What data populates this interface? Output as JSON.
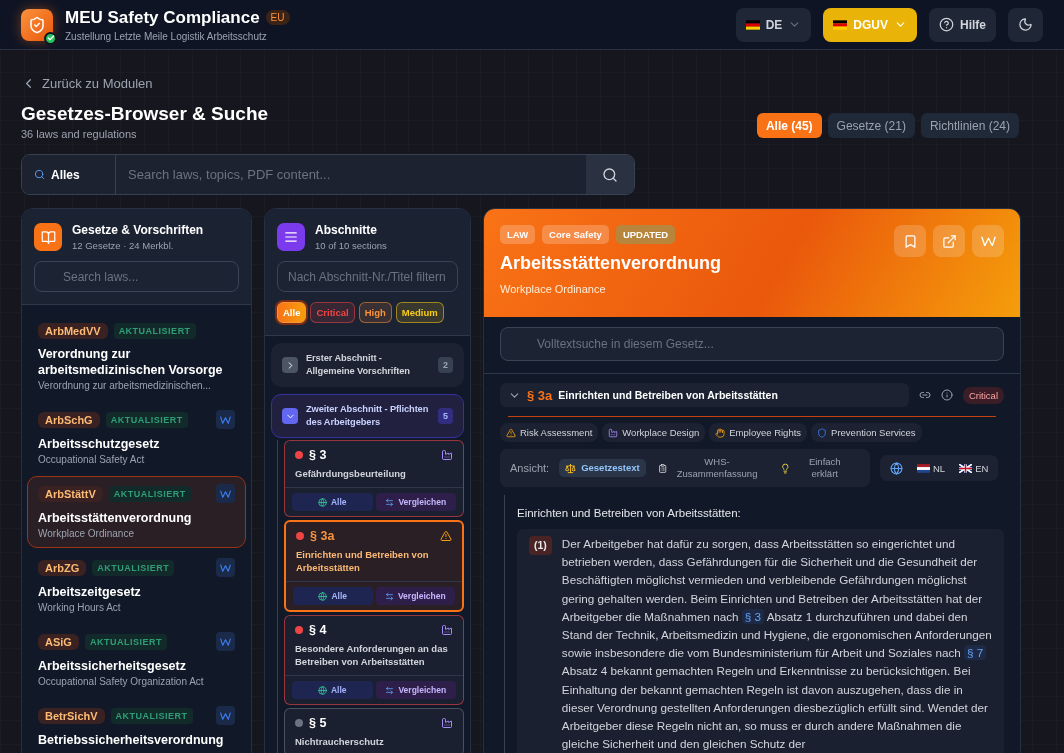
{
  "header": {
    "title": "MEU Safety Compliance",
    "region": "EU",
    "subtitle": "Zustellung Letzte Meile Logistik Arbeitsschutz",
    "language": "DE",
    "authority": "DGUV",
    "help": "Hilfe"
  },
  "page": {
    "back": "Zurück zu Modulen",
    "title": "Gesetzes-Browser & Suche",
    "subtitle": "36 laws and regulations",
    "filters": [
      {
        "label": "Alle (45)",
        "selected": true
      },
      {
        "label": "Gesetze (21)",
        "selected": false
      },
      {
        "label": "Richtlinien (24)",
        "selected": false
      }
    ],
    "scope": "Alles",
    "search_placeholder": "Search laws, topics, PDF content..."
  },
  "laws": {
    "title": "Gesetze & Vorschriften",
    "subtitle": "12 Gesetze · 24 Merkbl.",
    "search_placeholder": "Search laws...",
    "items": [
      {
        "abbr": "ArbMedVV",
        "status": "AKTUALISIERT",
        "title": "Verordnung zur arbeitsmedizinischen Vorsorge",
        "subtitle": "Verordnung zur arbeitsmedizinischen...",
        "wiki": false,
        "selected": false
      },
      {
        "abbr": "ArbSchG",
        "status": "AKTUALISIERT",
        "title": "Arbeitsschutzgesetz",
        "subtitle": "Occupational Safety Act",
        "wiki": true,
        "selected": false
      },
      {
        "abbr": "ArbStättV",
        "status": "AKTUALISIERT",
        "title": "Arbeitsstättenverordnung",
        "subtitle": "Workplace Ordinance",
        "wiki": true,
        "selected": true
      },
      {
        "abbr": "ArbZG",
        "status": "AKTUALISIERT",
        "title": "Arbeitszeitgesetz",
        "subtitle": "Working Hours Act",
        "wiki": true,
        "selected": false
      },
      {
        "abbr": "ASiG",
        "status": "AKTUALISIERT",
        "title": "Arbeitssicherheitsgesetz",
        "subtitle": "Occupational Safety Organization Act",
        "wiki": true,
        "selected": false
      },
      {
        "abbr": "BetrSichV",
        "status": "AKTUALISIERT",
        "title": "Betriebssicherheitsverordnung",
        "wiki": true,
        "selected": false
      }
    ]
  },
  "sections": {
    "title": "Abschnitte",
    "subtitle": "10 of 10 sections",
    "filter_placeholder": "Nach Abschnitt-Nr./Titel filtern",
    "severity": [
      {
        "label": "Alle",
        "selected": true,
        "color": "#f97316"
      },
      {
        "label": "Critical",
        "selected": false,
        "color": "#ef4444"
      },
      {
        "label": "High",
        "selected": false,
        "color": "#fb923c"
      },
      {
        "label": "Medium",
        "selected": false,
        "color": "#facc15"
      }
    ],
    "groups": [
      {
        "title": "Erster Abschnitt - Allgemeine Vorschriften",
        "count": "2",
        "expanded": false
      },
      {
        "title": "Zweiter Abschnitt - Pflichten des Arbeitgebers",
        "count": "5",
        "expanded": true,
        "children": [
          {
            "number": "§ 3",
            "title": "Gefährdungsbeurteilung",
            "color": "#ef4444",
            "kind": "factory",
            "selected": false,
            "buttons": [
              "Alle",
              "Vergleichen"
            ]
          },
          {
            "number": "§ 3a",
            "title": "Einrichten und Betreiben von Arbeitsstätten",
            "color": "#ef4444",
            "kind": "warning",
            "selected": true,
            "buttons": [
              "Alle",
              "Vergleichen"
            ]
          },
          {
            "number": "§ 4",
            "title": "Besondere Anforderungen an das Betreiben von Arbeitsstätten",
            "color": "#ef4444",
            "kind": "factory",
            "selected": false,
            "buttons": [
              "Alle",
              "Vergleichen"
            ]
          },
          {
            "number": "§ 5",
            "title": "Nichtraucherschutz",
            "color": "#6b7280",
            "kind": "factory",
            "selected": false
          }
        ]
      }
    ]
  },
  "detail": {
    "badges": [
      {
        "label": "LAW",
        "kind": "plain"
      },
      {
        "label": "Core Safety",
        "kind": "plain"
      },
      {
        "label": "UPDATED",
        "kind": "updated"
      }
    ],
    "title": "Arbeitsstättenverordnung",
    "subtitle": "Workplace Ordinance",
    "search_placeholder": "Volltextsuche in diesem Gesetz...",
    "section": {
      "number": "§ 3a",
      "title": "Einrichten und Betreiben von Arbeitsstätten",
      "expanded": true,
      "severity": "Critical"
    },
    "tags": [
      {
        "label": "Risk Assessment",
        "kind": "warning"
      },
      {
        "label": "Workplace Design",
        "kind": "factory"
      },
      {
        "label": "Employee Rights",
        "kind": "hand"
      },
      {
        "label": "Prevention Services",
        "kind": "shield"
      }
    ],
    "view_label": "Ansicht:",
    "views": [
      {
        "label": "Gesetzestext",
        "kind": "scale",
        "selected": true
      },
      {
        "label": "WHS-Zusammenfassung",
        "kind": "clipboard",
        "selected": false
      },
      {
        "label": "Einfach erklärt",
        "kind": "bulb",
        "selected": false
      }
    ],
    "languages": [
      {
        "label": "NL",
        "kind": "nl"
      },
      {
        "label": "EN",
        "kind": "gb"
      }
    ],
    "heading": "Einrichten und Betreiben von Arbeitsstätten:",
    "paragraph": {
      "number": "(1)",
      "parts": [
        {
          "kind": "text",
          "text": "Der Arbeitgeber hat dafür zu sorgen, dass Arbeitsstätten so eingerichtet und betrieben werden, dass Gefährdungen für die Sicherheit und die Gesundheit der Beschäftigten möglichst vermieden und verbleibende Gefährdungen möglichst gering gehalten werden. Beim Einrichten und Betreiben der Arbeitsstätten hat der Arbeitgeber die Maßnahmen nach "
        },
        {
          "kind": "ref",
          "text": "§ 3"
        },
        {
          "kind": "text",
          "text": " Absatz 1 durchzuführen und dabei den Stand der Technik, Arbeitsmedizin und Hygiene, die ergonomischen Anforderungen sowie insbesondere die vom Bundesministerium für Arbeit und Soziales nach "
        },
        {
          "kind": "ref",
          "text": "§ 7"
        },
        {
          "kind": "text",
          "text": " Absatz 4 bekannt gemachten Regeln und Erkenntnisse zu berücksichtigen. Bei Einhaltung der bekannt gemachten Regeln ist davon auszugehen, dass die in dieser Verordnung gestellten Anforderungen diesbezüglich erfüllt sind. Wendet der Arbeitgeber diese Regeln nicht an, so muss er durch andere Maßnahmen die gleiche Sicherheit und den gleichen Schutz der"
        }
      ]
    }
  }
}
